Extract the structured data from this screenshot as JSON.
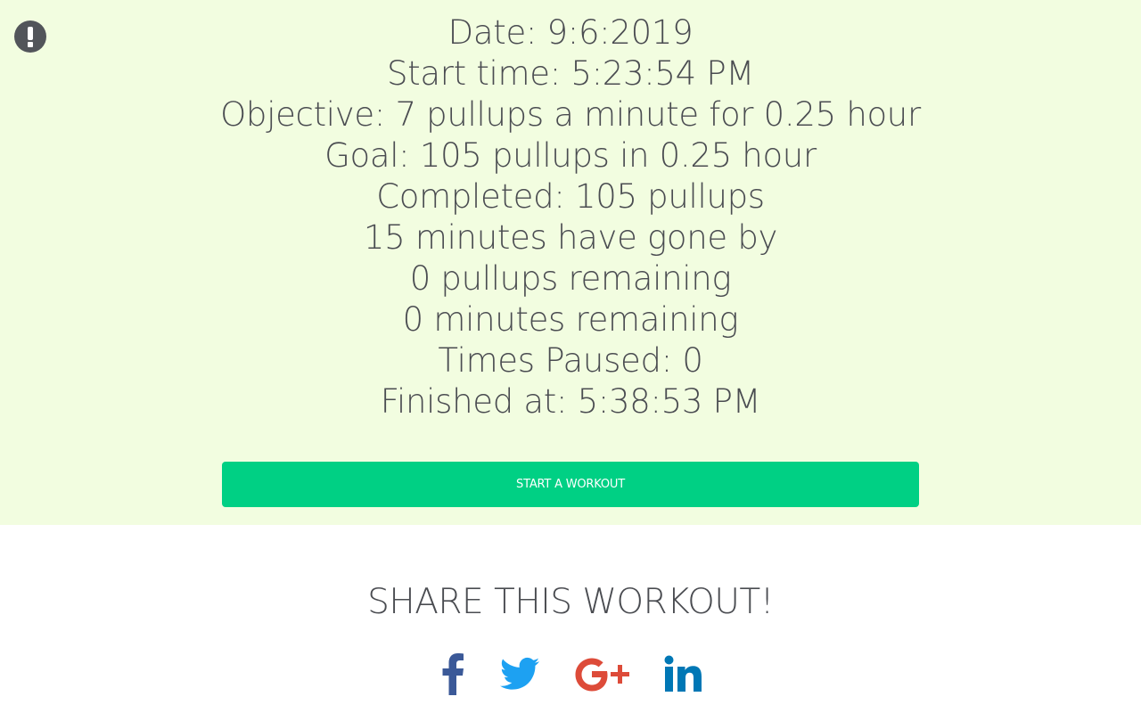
{
  "summary": {
    "date": "Date: 9:6:2019",
    "start_time": "Start time: 5:23:54 PM",
    "objective": "Objective: 7 pullups a minute for 0.25 hour",
    "goal": "Goal: 105 pullups in 0.25 hour",
    "completed": "Completed: 105 pullups",
    "elapsed": "15 minutes have gone by",
    "reps_remaining": "0 pullups remaining",
    "minutes_remaining": "0 minutes remaining",
    "times_paused": "Times Paused: 0",
    "finished_at": "Finished at: 5:38:53 PM"
  },
  "start_button": {
    "label": "START A WORKOUT"
  },
  "share": {
    "title": "SHARE THIS WORKOUT!",
    "networks": [
      {
        "icon": "facebook-icon",
        "color": "#3b5998"
      },
      {
        "icon": "twitter-icon",
        "color": "#1da1f2"
      },
      {
        "icon": "google-plus-icon",
        "color": "#dd4b39"
      },
      {
        "icon": "linkedin-icon",
        "color": "#0077b5"
      }
    ]
  },
  "colors": {
    "panel_background": "#f2fde0",
    "accent": "#00d084",
    "text": "#4a4c51",
    "alert_icon": "#52555a"
  }
}
